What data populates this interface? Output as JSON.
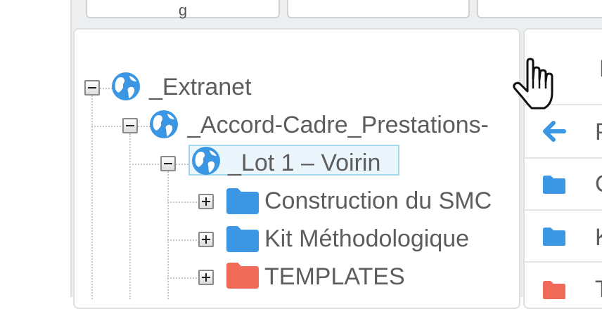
{
  "toolbar": {
    "buttons": [
      {
        "label": "g"
      },
      {
        "label": ""
      },
      {
        "label": ""
      }
    ]
  },
  "tree": {
    "nodes": [
      {
        "label": "_Extranet",
        "icon": "globe-icon",
        "state": "expanded",
        "level": 0
      },
      {
        "label": "_Accord-Cadre_Prestations-",
        "icon": "globe-icon",
        "state": "expanded",
        "level": 1
      },
      {
        "label": "_Lot 1 – Voirin",
        "icon": "globe-icon",
        "state": "expanded",
        "level": 2,
        "selected": true
      },
      {
        "label": "Construction du SMC",
        "icon": "folder-icon",
        "icon_color": "#3b97e3",
        "state": "collapsed",
        "level": 3
      },
      {
        "label": "Kit Méthodologique",
        "icon": "folder-icon",
        "icon_color": "#3b97e3",
        "state": "collapsed",
        "level": 3
      },
      {
        "label": "TEMPLATES",
        "icon": "folder-icon",
        "icon_color": "#f06a5a",
        "state": "collapsed",
        "level": 3
      }
    ]
  },
  "file_list": {
    "header_label": "N",
    "rows": [
      {
        "icon": "back-arrow-icon",
        "label": "P",
        "icon_color": "#3b97e3"
      },
      {
        "icon": "folder-icon",
        "label": "C",
        "icon_color": "#3b97e3"
      },
      {
        "icon": "folder-icon",
        "label": "K",
        "icon_color": "#3b97e3"
      },
      {
        "icon": "folder-icon",
        "label": "T",
        "icon_color": "#f06a5a"
      }
    ]
  },
  "colors": {
    "accent_blue": "#3b97e3",
    "folder_red": "#f06a5a",
    "selection_bg": "#eaf6fc",
    "selection_border": "#a8d8ee",
    "text": "#5d5d5d"
  },
  "cursor": {
    "icon": "hand-pointer-icon"
  }
}
